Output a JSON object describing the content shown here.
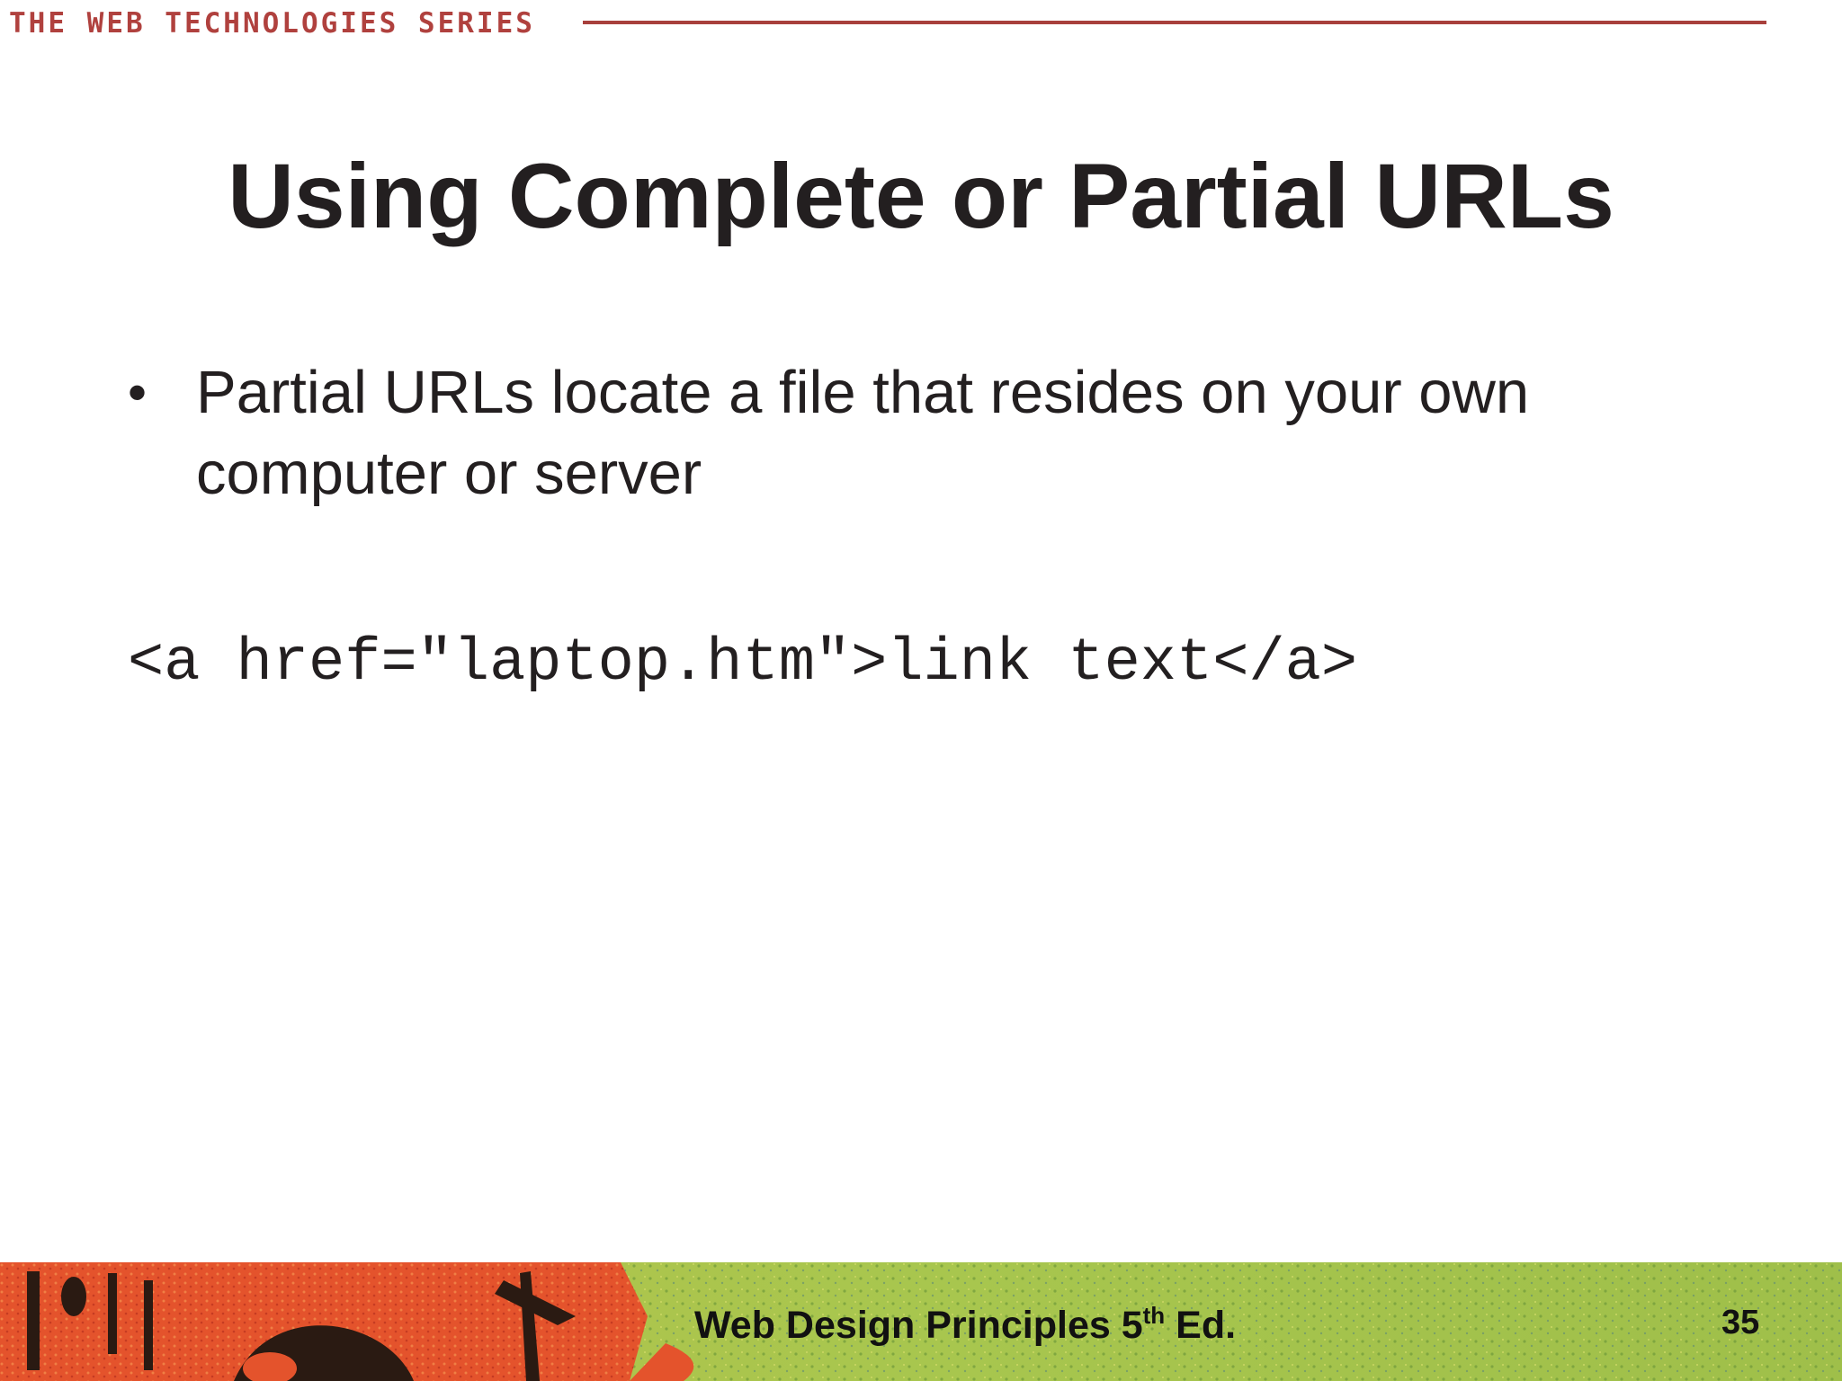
{
  "header": {
    "series": "THE WEB TECHNOLOGIES SERIES"
  },
  "title": "Using Complete or Partial URLs",
  "bullets": [
    "Partial URLs locate a file that resides on your own computer or server"
  ],
  "code": "<a href=\"laptop.htm\">link text</a>",
  "footer": {
    "book_title_main": "Web Design Principles 5",
    "book_title_sup": "th",
    "book_title_end": " Ed.",
    "page_number": "35"
  },
  "colors": {
    "accent": "#b0413e",
    "text": "#231f20",
    "footer_orange": "#e5542a",
    "footer_green": "#a9c24a"
  },
  "icons": {
    "bullet": "bullet-dot-icon"
  }
}
